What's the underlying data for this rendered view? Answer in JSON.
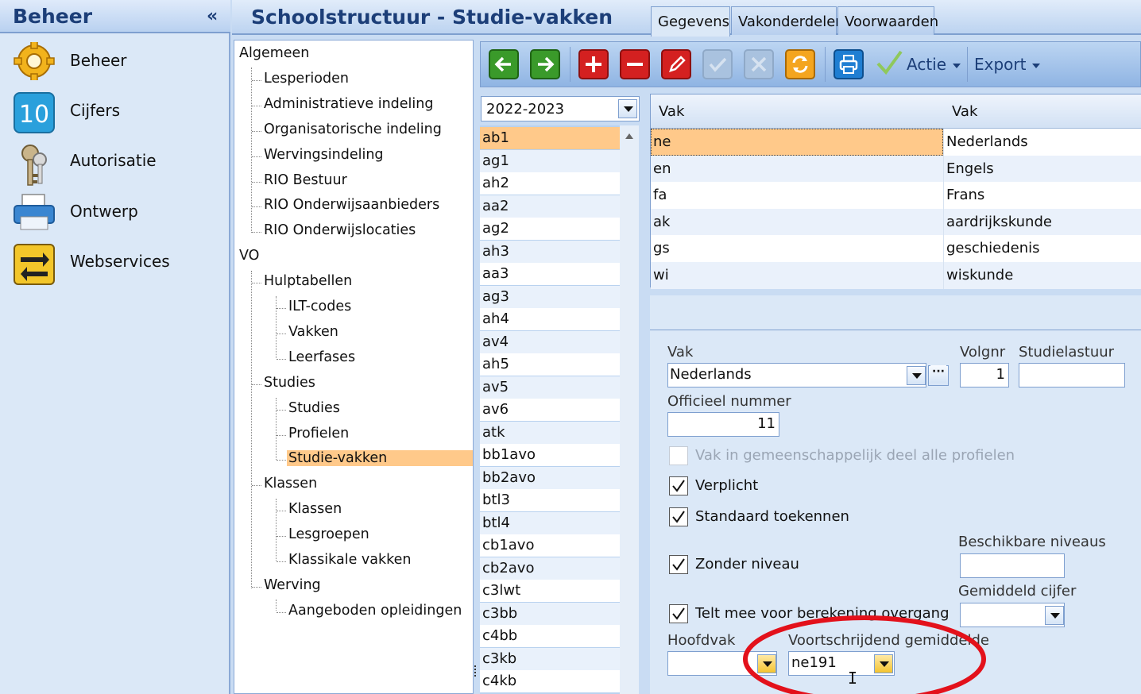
{
  "sidebar": {
    "title": "Beheer",
    "collapse": "«",
    "items": [
      {
        "label": "Beheer",
        "icon": "gear-icon"
      },
      {
        "label": "Cijfers",
        "icon": "grade-10-icon"
      },
      {
        "label": "Autorisatie",
        "icon": "keys-icon"
      },
      {
        "label": "Ontwerp",
        "icon": "printer-icon"
      },
      {
        "label": "Webservices",
        "icon": "exchange-arrows-icon"
      }
    ]
  },
  "header": {
    "title": "Schoolstructuur - Studie-vakken"
  },
  "tree": {
    "nodes": [
      {
        "label": "Algemeen",
        "level": 0
      },
      {
        "label": "Lesperioden",
        "level": 1
      },
      {
        "label": "Administratieve indeling",
        "level": 1
      },
      {
        "label": "Organisatorische indeling",
        "level": 1
      },
      {
        "label": "Wervingsindeling",
        "level": 1
      },
      {
        "label": "RIO Bestuur",
        "level": 1
      },
      {
        "label": "RIO Onderwijsaanbieders",
        "level": 1
      },
      {
        "label": "RIO Onderwijslocaties",
        "level": 1
      },
      {
        "label": "VO",
        "level": 0
      },
      {
        "label": "Hulptabellen",
        "level": 1
      },
      {
        "label": "ILT-codes",
        "level": 2
      },
      {
        "label": "Vakken",
        "level": 2
      },
      {
        "label": "Leerfases",
        "level": 2
      },
      {
        "label": "Studies",
        "level": 1
      },
      {
        "label": "Studies",
        "level": 2
      },
      {
        "label": "Profielen",
        "level": 2
      },
      {
        "label": "Studie-vakken",
        "level": 2,
        "selected": true
      },
      {
        "label": "Klassen",
        "level": 1
      },
      {
        "label": "Klassen",
        "level": 2
      },
      {
        "label": "Lesgroepen",
        "level": 2
      },
      {
        "label": "Klassikale vakken",
        "level": 2
      },
      {
        "label": "Werving",
        "level": 1
      },
      {
        "label": "Aangeboden opleidingen",
        "level": 2
      }
    ]
  },
  "toolbar": {
    "buttons": [
      "back-arrow-icon",
      "forward-arrow-icon",
      "add-icon",
      "remove-icon",
      "edit-pencil-icon",
      "confirm-check-icon",
      "cancel-x-icon",
      "refresh-icon",
      "print-icon"
    ],
    "actie_label": "Actie",
    "export_label": "Export"
  },
  "year": {
    "value": "2022-2023"
  },
  "studies": [
    "ab1",
    "ag1",
    "ah2",
    "aa2",
    "ag2",
    "ah3",
    "aa3",
    "ag3",
    "ah4",
    "av4",
    "ah5",
    "av5",
    "av6",
    "atk",
    "bb1avo",
    "bb2avo",
    "btl3",
    "btl4",
    "cb1avo",
    "cb2avo",
    "c3lwt",
    "c3bb",
    "c4bb",
    "c3kb",
    "c4kb"
  ],
  "grid": {
    "headers": [
      "Vak",
      "Vak"
    ],
    "rows": [
      {
        "code": "ne",
        "name": "Nederlands",
        "selected": true
      },
      {
        "code": "en",
        "name": "Engels"
      },
      {
        "code": "fa",
        "name": "Frans"
      },
      {
        "code": "ak",
        "name": "aardrijkskunde"
      },
      {
        "code": "gs",
        "name": "geschiedenis"
      },
      {
        "code": "wi",
        "name": "wiskunde"
      }
    ]
  },
  "tabs": [
    "Gegevens",
    "Vakonderdelen",
    "Voorwaarden"
  ],
  "form": {
    "vak_label": "Vak",
    "vak_value": "Nederlands",
    "ellipsis": "···",
    "volgnr_label": "Volgnr",
    "volgnr_value": "1",
    "studielastuur_label": "Studielastuur",
    "studielastuur_value": "",
    "officieel_label": "Officieel nummer",
    "officieel_value": "11",
    "gemeenschappelijk_label": "Vak in gemeenschappelijk deel alle profielen",
    "verplicht_label": "Verplicht",
    "standaard_label": "Standaard toekennen",
    "zonder_label": "Zonder niveau",
    "telt_label": "Telt mee voor berekening overgang",
    "beschikbare_label": "Beschikbare niveaus",
    "beschikbare_value": "",
    "gemiddeld_label": "Gemiddeld cijfer",
    "gemiddeld_value": "",
    "hoofdvak_label": "Hoofdvak",
    "hoofdvak_value": "",
    "voortschrijdend_label": "Voortschrijdend gemiddelde",
    "voortschrijdend_value": "ne191"
  },
  "colors": {
    "selection": "#ffc98a",
    "header_text": "#1c3e78",
    "highlight_ellipse": "#e3111b"
  }
}
